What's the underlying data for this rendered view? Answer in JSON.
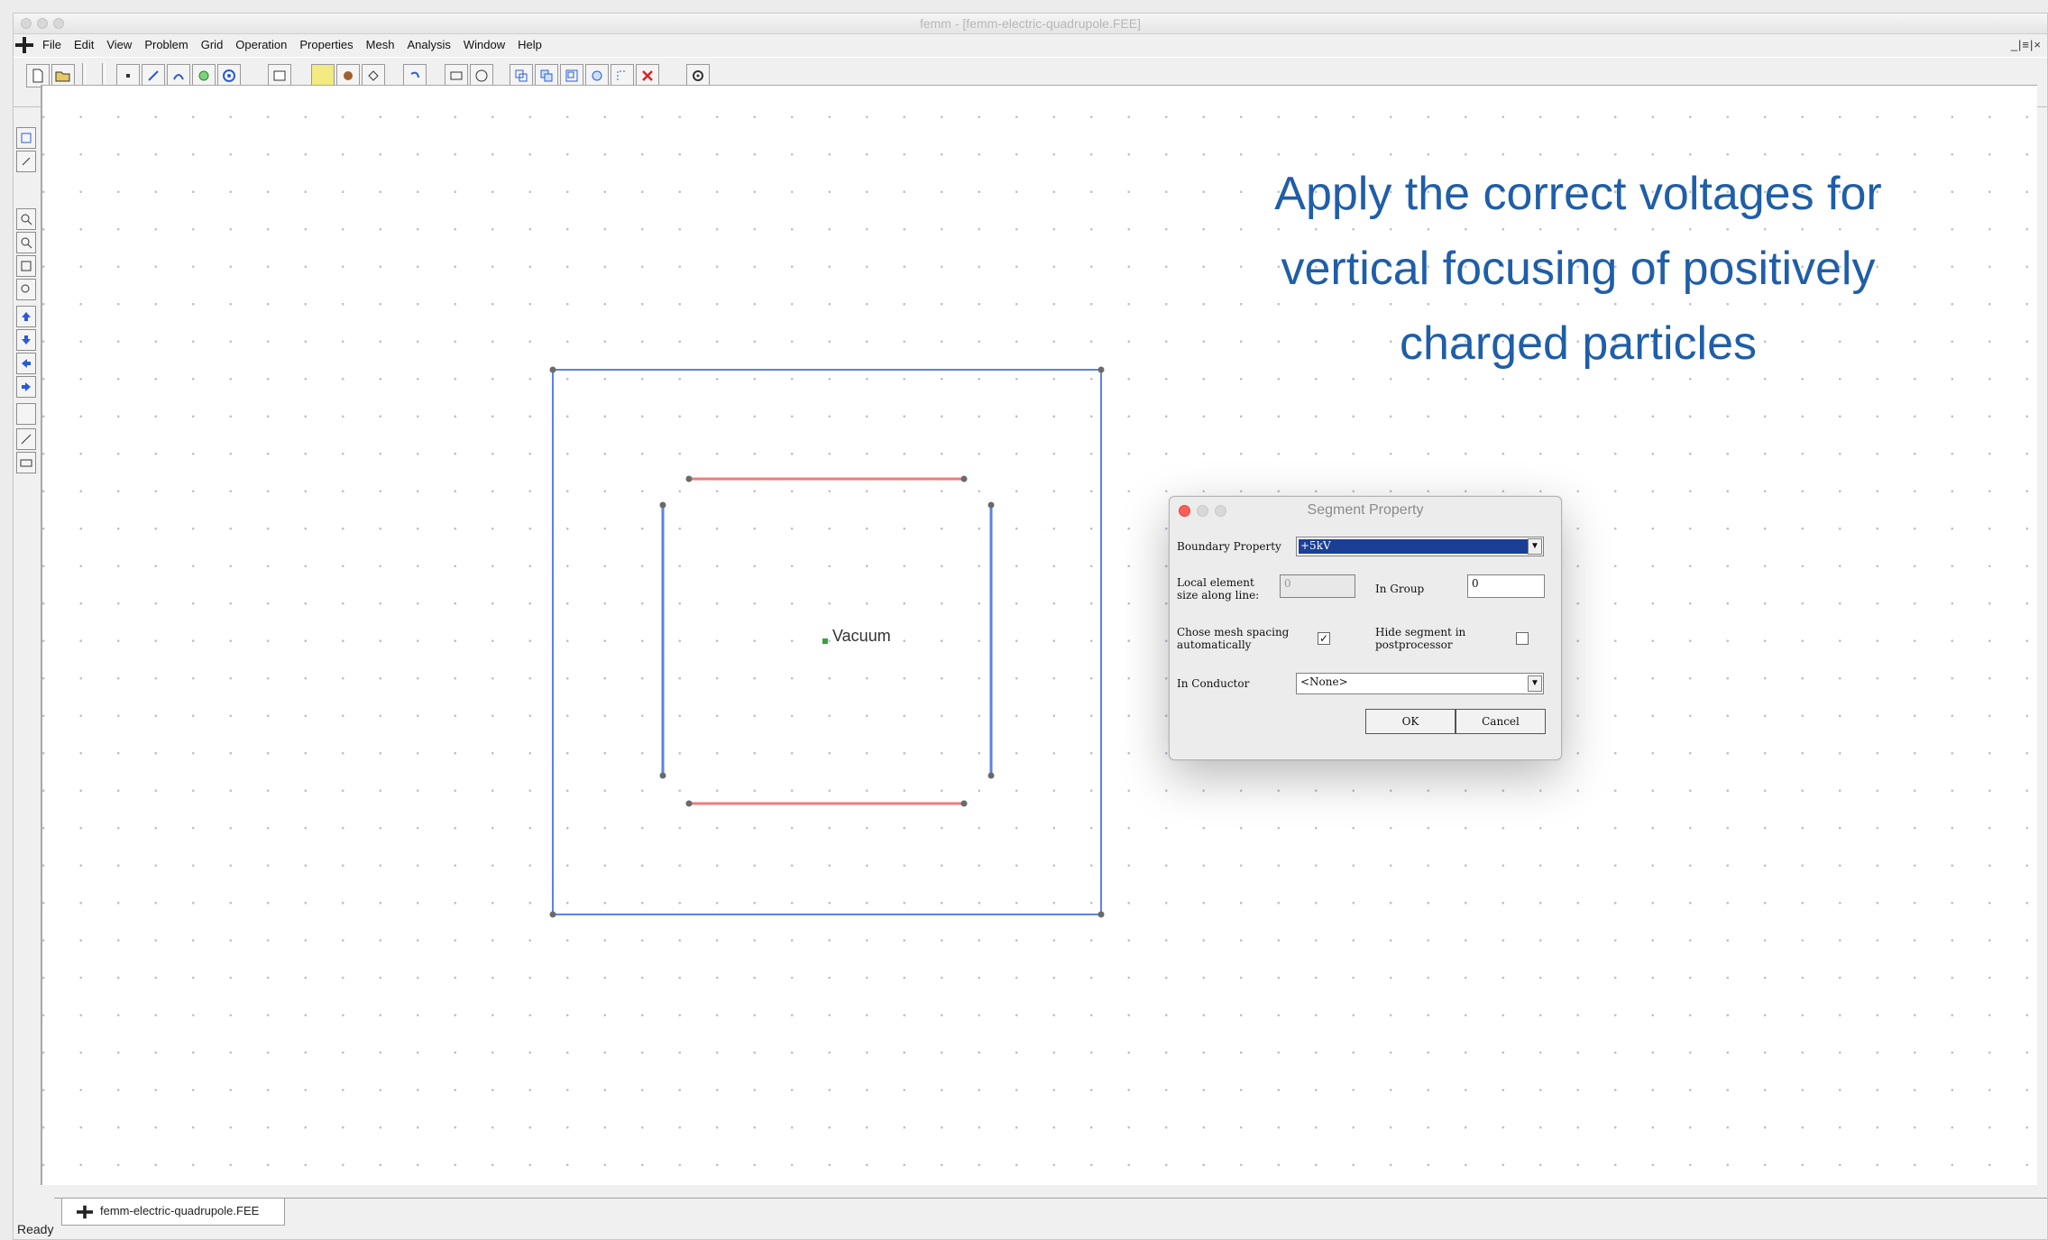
{
  "window": {
    "title": "femm - [femm-electric-quadrupole.FEE]",
    "mdi_controls": "_|≡|×"
  },
  "menu": [
    "File",
    "Edit",
    "View",
    "Problem",
    "Grid",
    "Operation",
    "Properties",
    "Mesh",
    "Analysis",
    "Window",
    "Help"
  ],
  "canvas": {
    "region_label": "Vacuum",
    "annotation": "Apply the correct voltages for vertical focusing of positively charged particles",
    "colors": {
      "outer_boundary": "#5a82e8",
      "vertical_electrodes": "#5a82e8",
      "horizontal_electrodes": "#ef7c7c",
      "node": "#6a6a6a",
      "block_label_marker": "#3aa03a",
      "annotation": "#1f5ea8"
    }
  },
  "dialog": {
    "title": "Segment Property",
    "boundary_property_label": "Boundary Property",
    "boundary_property_value": "+5kV",
    "local_element_size_label": "Local element size along line:",
    "local_element_size_value": "0",
    "in_group_label": "In Group",
    "in_group_value": "0",
    "auto_mesh_label": "Chose mesh spacing automatically",
    "auto_mesh_checked": "✓",
    "hide_segment_label": "Hide segment in postprocessor",
    "in_conductor_label": "In Conductor",
    "in_conductor_value": "<None>",
    "ok_label": "OK",
    "cancel_label": "Cancel"
  },
  "tab": {
    "label": "femm-electric-quadrupole.FEE"
  },
  "status": {
    "text": "Ready"
  }
}
